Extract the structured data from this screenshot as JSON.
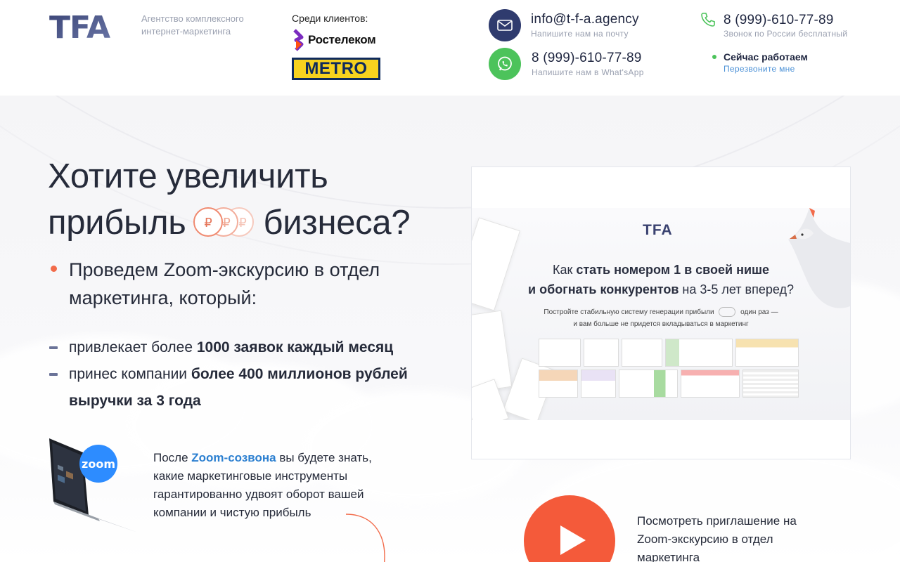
{
  "header": {
    "logo_text": "TFA",
    "tagline": "Агентство комплексного интернет-маркетинга",
    "clients_label": "Среди клиентов:",
    "clients": [
      "Ростелеком",
      "METRO"
    ],
    "email": "info@t-f-a.agency",
    "email_sub": "Напишите нам на почту",
    "whatsapp_phone": "8 (999)-610-77-89",
    "whatsapp_sub": "Напишите нам в What'sApp",
    "phone": "8 (999)-610-77-89",
    "phone_sub": "Звонок по России бесплатный",
    "status": "Сейчас работаем",
    "callback": "Перезвоните мне"
  },
  "hero": {
    "headline_line1": "Хотите увеличить",
    "headline_line2_a": "прибыль",
    "headline_line2_b": "бизнеса?",
    "bullet": "Проведем Zoom-экскурсию в отдел маркетинга, который:",
    "sub_items": [
      {
        "pre": "привлекает более ",
        "bold": "1000 заявок каждый месяц"
      },
      {
        "pre": "принес компании ",
        "bold": "более 400 миллионов рублей выручки за 3 года"
      }
    ],
    "zoom_badge": "zoom",
    "after_pre": "После ",
    "after_hl": "Zoom-созвона",
    "after_post": " вы будете знать, какие маркетинговые инструменты гарантированно удвоят оборот вашей компании и чистую прибыль"
  },
  "video": {
    "logo": "TFA",
    "title_a": "Как ",
    "title_b": "стать номером 1 в своей нише",
    "title_c": "и обогнать конкурентов",
    "title_d": " на 3-5 лет вперед?",
    "subtitle_a": "Постройте стабильную систему генерации прибыли",
    "subtitle_b": "один раз —",
    "subtitle_c": "и вам больше не придется вкладываться в маркетинг",
    "play_label": "Посмотреть приглашение на Zoom-экскурсию в отдел маркетинга"
  },
  "colors": {
    "accent": "#f45a3a",
    "navy": "#2f3b6e",
    "whatsapp": "#4cc35b",
    "link": "#2b7fd0"
  }
}
